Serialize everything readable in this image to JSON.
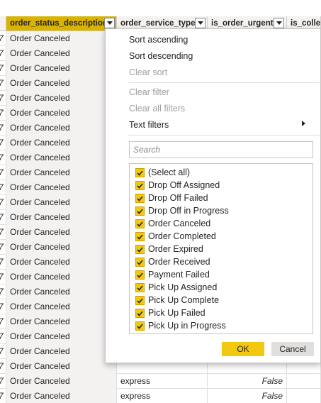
{
  "table": {
    "columns": [
      {
        "label": ""
      },
      {
        "label": "order_status_description"
      },
      {
        "label": "order_service_type"
      },
      {
        "label": "is_order_urgent"
      },
      {
        "label": "is_collect"
      }
    ],
    "rows": [
      {
        "c0": "7",
        "status": "Order Canceled",
        "service": "",
        "urgent": ""
      },
      {
        "c0": "7",
        "status": "Order Canceled",
        "service": "",
        "urgent": ""
      },
      {
        "c0": "7",
        "status": "Order Canceled",
        "service": "",
        "urgent": ""
      },
      {
        "c0": "7",
        "status": "Order Canceled",
        "service": "",
        "urgent": ""
      },
      {
        "c0": "7",
        "status": "Order Canceled",
        "service": "",
        "urgent": ""
      },
      {
        "c0": "7",
        "status": "Order Canceled",
        "service": "",
        "urgent": ""
      },
      {
        "c0": "7",
        "status": "Order Canceled",
        "service": "",
        "urgent": ""
      },
      {
        "c0": "7",
        "status": "Order Canceled",
        "service": "",
        "urgent": ""
      },
      {
        "c0": "7",
        "status": "Order Canceled",
        "service": "",
        "urgent": ""
      },
      {
        "c0": "7",
        "status": "Order Canceled",
        "service": "",
        "urgent": ""
      },
      {
        "c0": "7",
        "status": "Order Canceled",
        "service": "",
        "urgent": ""
      },
      {
        "c0": "7",
        "status": "Order Canceled",
        "service": "",
        "urgent": ""
      },
      {
        "c0": "7",
        "status": "Order Canceled",
        "service": "",
        "urgent": ""
      },
      {
        "c0": "7",
        "status": "Order Canceled",
        "service": "",
        "urgent": ""
      },
      {
        "c0": "7",
        "status": "Order Canceled",
        "service": "",
        "urgent": ""
      },
      {
        "c0": "7",
        "status": "Order Canceled",
        "service": "",
        "urgent": ""
      },
      {
        "c0": "7",
        "status": "Order Canceled",
        "service": "",
        "urgent": ""
      },
      {
        "c0": "7",
        "status": "Order Canceled",
        "service": "",
        "urgent": ""
      },
      {
        "c0": "7",
        "status": "Order Canceled",
        "service": "",
        "urgent": ""
      },
      {
        "c0": "7",
        "status": "Order Canceled",
        "service": "",
        "urgent": ""
      },
      {
        "c0": "7",
        "status": "Order Canceled",
        "service": "",
        "urgent": ""
      },
      {
        "c0": "7",
        "status": "Order Canceled",
        "service": "",
        "urgent": ""
      },
      {
        "c0": "7",
        "status": "Order Canceled",
        "service": "",
        "urgent": ""
      },
      {
        "c0": "7",
        "status": "Order Canceled",
        "service": "express",
        "urgent": "False"
      },
      {
        "c0": "7",
        "status": "Order Canceled",
        "service": "express",
        "urgent": "False"
      },
      {
        "c0": "7",
        "status": "Order Canceled",
        "service": "express",
        "urgent": "False"
      }
    ]
  },
  "filter_menu": {
    "sort_ascending": "Sort ascending",
    "sort_descending": "Sort descending",
    "clear_sort": "Clear sort",
    "clear_filter": "Clear filter",
    "clear_all_filters": "Clear all filters",
    "text_filters": "Text filters",
    "search_placeholder": "Search",
    "options": [
      {
        "label": "(Select all)",
        "checked": true
      },
      {
        "label": "Drop Off Assigned",
        "checked": true
      },
      {
        "label": "Drop Off Failed",
        "checked": true
      },
      {
        "label": "Drop Off in Progress",
        "checked": true
      },
      {
        "label": "Order Canceled",
        "checked": true
      },
      {
        "label": "Order Completed",
        "checked": true
      },
      {
        "label": "Order Expired",
        "checked": true
      },
      {
        "label": "Order Received",
        "checked": true
      },
      {
        "label": "Payment Failed",
        "checked": true
      },
      {
        "label": "Pick Up Assigned",
        "checked": true
      },
      {
        "label": "Pick Up Complete",
        "checked": true
      },
      {
        "label": "Pick Up Failed",
        "checked": true
      },
      {
        "label": "Pick Up in Progress",
        "checked": true
      }
    ],
    "ok_label": "OK",
    "cancel_label": "Cancel"
  },
  "colors": {
    "selected_header": "#d9b300",
    "checkbox": "#f2c811",
    "ok_button": "#f2c811"
  }
}
